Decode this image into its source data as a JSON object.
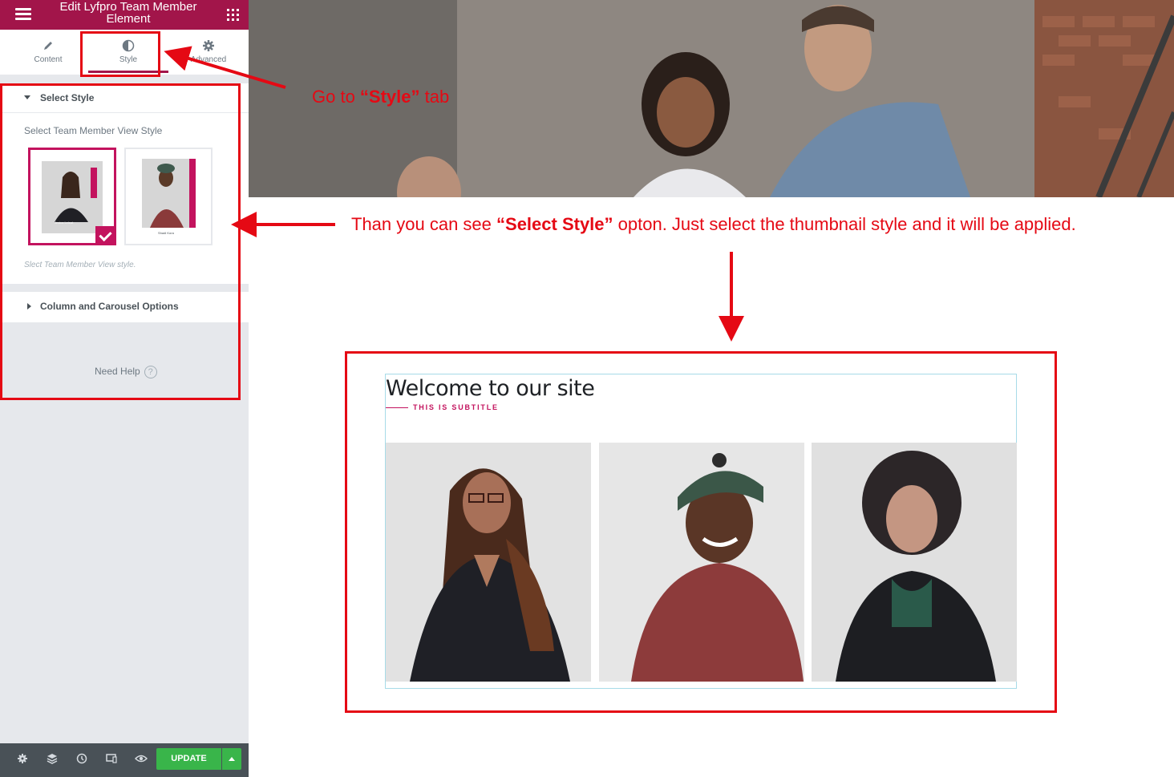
{
  "panel": {
    "title": "Edit Lyfpro Team Member Element",
    "tabs": [
      {
        "label": "Content",
        "icon": "pencil-icon"
      },
      {
        "label": "Style",
        "icon": "half-circle-icon",
        "active": true
      },
      {
        "label": "Advanced",
        "icon": "gear-icon"
      }
    ],
    "section_select_style": {
      "heading": "Select Style",
      "field_label": "Select Team Member View Style",
      "note": "Slect Team Member View style.",
      "options": [
        {
          "name": "style-1",
          "selected": true,
          "caption": "Jesica Leleat"
        },
        {
          "name": "style-2",
          "selected": false,
          "caption": "Shadi Kora"
        }
      ]
    },
    "section_column": {
      "heading": "Column and Carousel Options"
    },
    "help": {
      "label": "Need Help",
      "icon": "question-icon"
    },
    "footer": {
      "icons": [
        "settings-icon",
        "layers-icon",
        "history-icon",
        "responsive-icon",
        "eye-icon"
      ],
      "update_label": "UPDATE"
    }
  },
  "annotations": {
    "step1_pre": "Go  to ",
    "step1_bold": "“Style”",
    "step1_post": " tab",
    "step2_pre": "Than you  can see ",
    "step2_bold": "“Select Style”",
    "step2_post": " opton. Just select the thumbnail style and it will be applied.",
    "color": "#e50914"
  },
  "preview": {
    "title": "Welcome to our site",
    "subtitle": "THIS IS SUBTITLE",
    "members": [
      "member-photo-woman-glasses",
      "member-photo-man-cap",
      "member-photo-woman-curly"
    ]
  },
  "colors": {
    "brand": "#a2154a",
    "accent": "#c3135e",
    "update": "#39b54a"
  }
}
